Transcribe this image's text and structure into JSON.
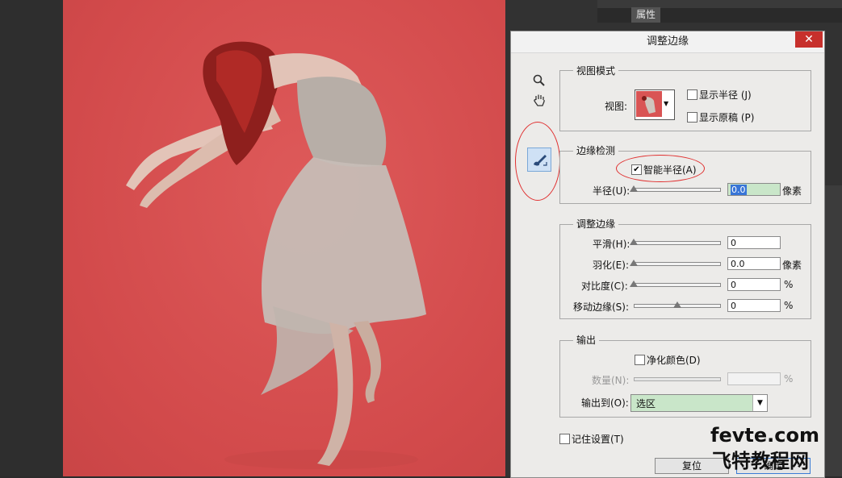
{
  "panel": {
    "tab_label": "属性"
  },
  "dialog": {
    "title": "调整边缘",
    "close": "✕",
    "view_mode": {
      "group_title": "视图模式",
      "view_label": "视图:",
      "show_radius": "显示半径 (J)",
      "show_original": "显示原稿 (P)"
    },
    "edge_detection": {
      "group_title": "边缘检测",
      "smart_radius": "智能半径(A)",
      "radius_label": "半径(U):",
      "radius_value": "0.0",
      "radius_unit": "像素"
    },
    "adjust_edge": {
      "group_title": "调整边缘",
      "rows": [
        {
          "label": "平滑(H):",
          "value": "0",
          "unit": ""
        },
        {
          "label": "羽化(E):",
          "value": "0.0",
          "unit": "像素"
        },
        {
          "label": "对比度(C):",
          "value": "0",
          "unit": "%"
        },
        {
          "label": "移动边缘(S):",
          "value": "0",
          "unit": "%"
        }
      ]
    },
    "output": {
      "group_title": "输出",
      "decontaminate": "净化颜色(D)",
      "amount_label": "数量(N):",
      "amount_unit": "%",
      "output_to_label": "输出到(O):",
      "output_to_value": "选区"
    },
    "remember": "记住设置(T)",
    "reset_button": "复位",
    "ok_button": "确定"
  },
  "watermark": {
    "line1": "fevte.com",
    "line2": "飞特教程网"
  },
  "colors": {
    "canvas_bg": "#d94f50",
    "dialog_bg": "#ecebe9",
    "close_red": "#c7302c",
    "highlight_green": "#c9e6c9",
    "annotation_red": "#e03030"
  }
}
